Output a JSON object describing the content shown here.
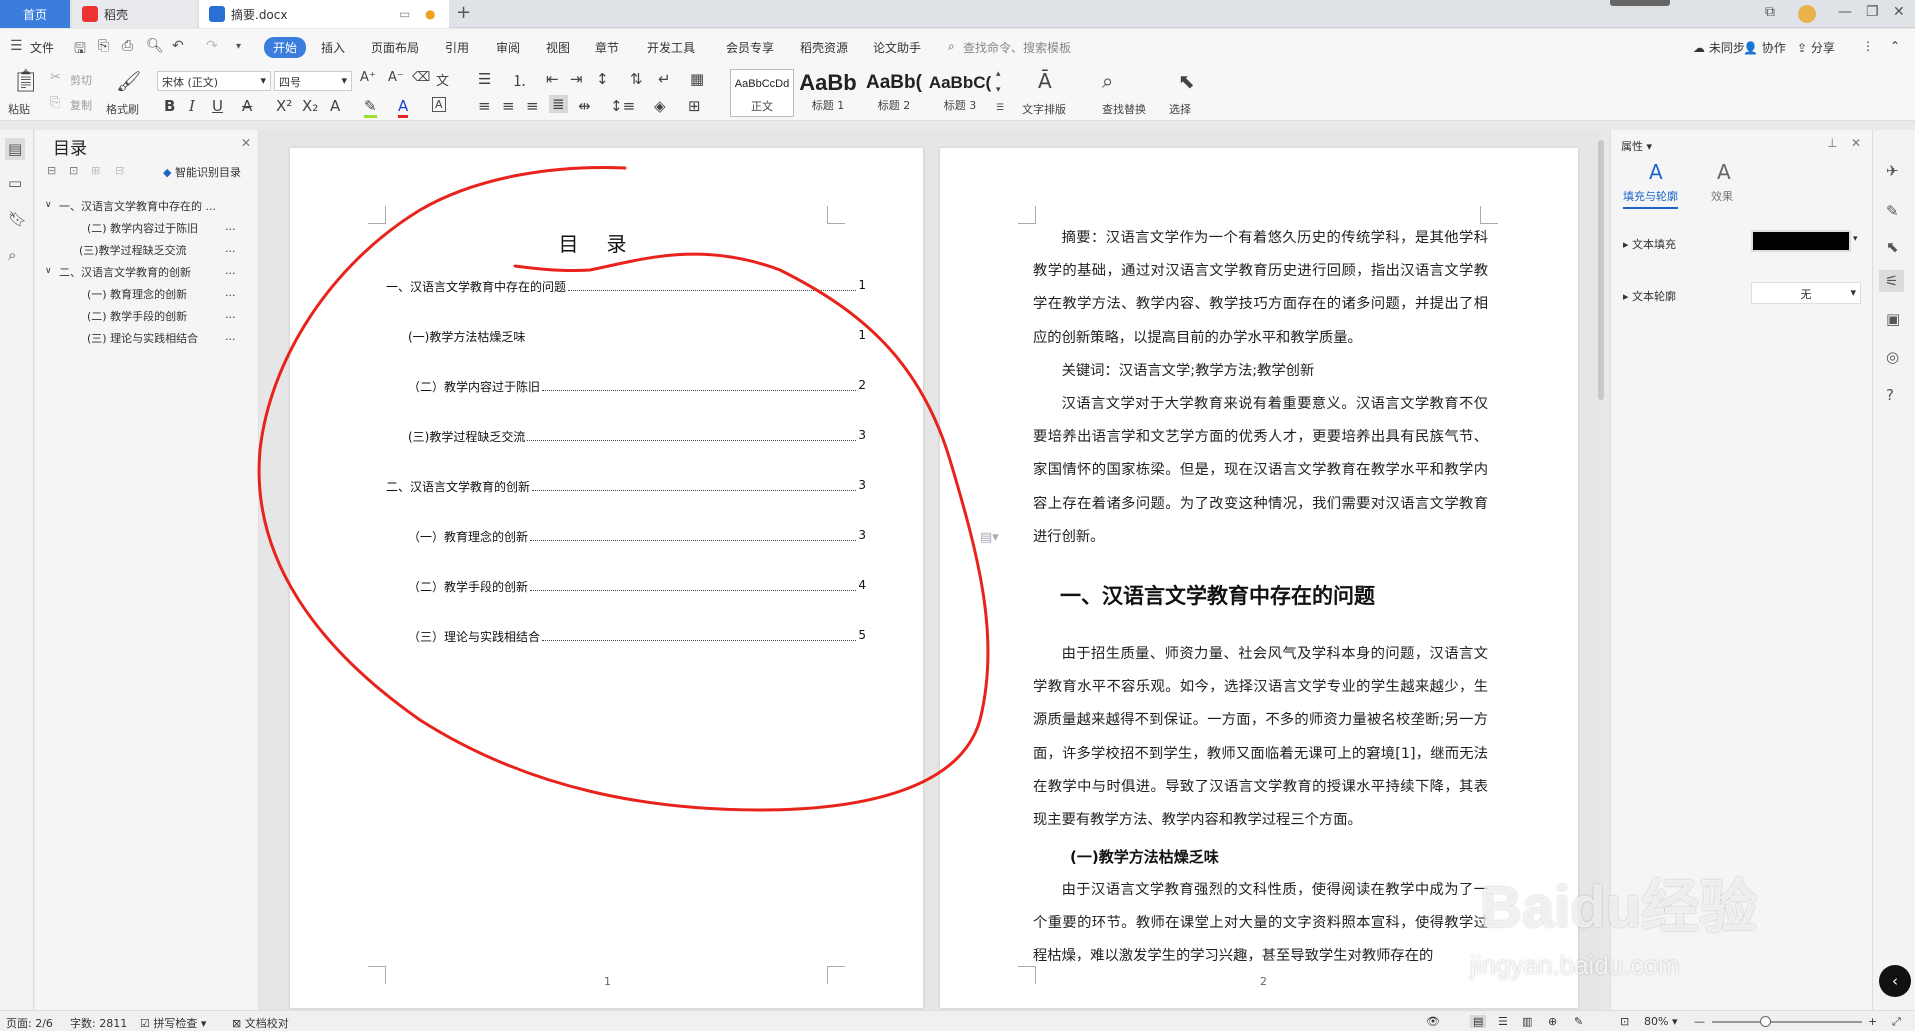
{
  "tabs": {
    "home": "首页",
    "daoke": "稻壳",
    "doc": "摘要.docx"
  },
  "menubar": {
    "file": "文件",
    "items": [
      "开始",
      "插入",
      "页面布局",
      "引用",
      "审阅",
      "视图",
      "章节",
      "开发工具",
      "会员专享",
      "稻壳资源",
      "论文助手"
    ],
    "search_placeholder": "查找命令、搜索模板",
    "sync": "未同步",
    "collab": "协作",
    "share": "分享"
  },
  "ribbon": {
    "paste": "粘贴",
    "cut": "剪切",
    "copy": "复制",
    "format_painter": "格式刷",
    "font_name": "宋体 (正文)",
    "font_size": "四号",
    "styles": [
      {
        "preview": "AaBbCcDd",
        "label": "正文"
      },
      {
        "preview": "AaBb",
        "label": "标题 1"
      },
      {
        "preview": "AaBb(",
        "label": "标题 2"
      },
      {
        "preview": "AaBbC(",
        "label": "标题 3"
      }
    ],
    "text_layout": "文字排版",
    "find_replace": "查找替换",
    "select": "选择"
  },
  "toc_panel": {
    "title": "目录",
    "smart": "智能识别目录",
    "items": [
      "一、汉语言文学教育中存在的 ...",
      "(二) 教学内容过于陈旧",
      "(三)教学过程缺乏交流",
      "二、汉语言文学教育的创新",
      "(一) 教育理念的创新",
      "(二) 教学手段的创新",
      "(三) 理论与实践相结合"
    ],
    "more": "..."
  },
  "page1": {
    "title": "目录",
    "entries": [
      {
        "text": "一、汉语言文学教育中存在的问题",
        "page": "1"
      },
      {
        "text": "(一)教学方法枯燥乏味",
        "page": "1"
      },
      {
        "text": "（二）教学内容过于陈旧",
        "page": "2"
      },
      {
        "text": "(三)教学过程缺乏交流",
        "page": "3"
      },
      {
        "text": "二、汉语言文学教育的创新",
        "page": "3"
      },
      {
        "text": "（一）教育理念的创新",
        "page": "3"
      },
      {
        "text": "（二）教学手段的创新",
        "page": "4"
      },
      {
        "text": "（三）理论与实践相结合",
        "page": "5"
      }
    ],
    "page_number": "1"
  },
  "page2": {
    "abstract": "摘要：汉语言文学作为一个有着悠久历史的传统学科，是其他学科教学的基础，通过对汉语言文学教育历史进行回顾，指出汉语言文学教学在教学方法、教学内容、教学技巧方面存在的诸多问题，并提出了相应的创新策略，以提高目前的办学水平和教学质量。",
    "keywords": "关键词：汉语言文学;教学方法;教学创新",
    "intro": "汉语言文学对于大学教育来说有着重要意义。汉语言文学教育不仅要培养出语言学和文艺学方面的优秀人才，更要培养出具有民族气节、家国情怀的国家栋梁。但是，现在汉语言文学教育在教学水平和教学内容上存在着诸多问题。为了改变这种情况，我们需要对汉语言文学教育进行创新。",
    "heading": "一、汉语言文学教育中存在的问题",
    "para1": "由于招生质量、师资力量、社会风气及学科本身的问题，汉语言文学教育水平不容乐观。如今，选择汉语言文学专业的学生越来越少，生源质量越来越得不到保证。一方面，不多的师资力量被名校垄断;另一方面，许多学校招不到学生，教师又面临着无课可上的窘境[1]，继而无法在教学中与时俱进。导致了汉语言文学教育的授课水平持续下降，其表现主要有教学方法、教学内容和教学过程三个方面。",
    "subheading": "(一)教学方法枯燥乏味",
    "para2": "由于汉语言文学教育强烈的文科性质，使得阅读在教学中成为了一个重要的环节。教师在课堂上对大量的文字资料照本宣科，使得教学过程枯燥，难以激发学生的学习兴趣，甚至导致学生对教师存在的",
    "page_number": "2"
  },
  "right_panel": {
    "header": "属性",
    "tab_fill": "填充与轮廓",
    "tab_effect": "效果",
    "text_fill": "文本填充",
    "text_outline": "文本轮廓",
    "outline_value": "无",
    "fill_color": "#000000"
  },
  "statusbar": {
    "page": "页面: 2/6",
    "words": "字数: 2811",
    "spell": "拼写检查",
    "proof": "文档校对",
    "zoom": "80%"
  },
  "watermark": {
    "brand": "Baidu经验",
    "url": "jingyan.baidu.com"
  },
  "colors": {
    "accent": "#3b7ddd",
    "annotation": "#e8231b"
  }
}
